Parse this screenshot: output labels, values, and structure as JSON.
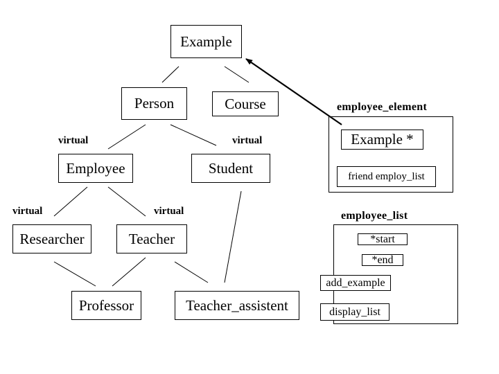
{
  "hierarchy": {
    "nodes": {
      "example": "Example",
      "person": "Person",
      "course": "Course",
      "employee": "Employee",
      "student": "Student",
      "researcher": "Researcher",
      "teacher": "Teacher",
      "professor": "Professor",
      "teacher_assistent": "Teacher_assistent"
    },
    "inheritance_labels": {
      "employee_virtual": "virtual",
      "student_virtual": "virtual",
      "researcher_virtual": "virtual",
      "teacher_virtual": "virtual"
    },
    "edges": [
      {
        "from": "example",
        "to": "person"
      },
      {
        "from": "example",
        "to": "course"
      },
      {
        "from": "person",
        "to": "employee",
        "virtual": true
      },
      {
        "from": "person",
        "to": "student",
        "virtual": true
      },
      {
        "from": "employee",
        "to": "researcher",
        "virtual": true
      },
      {
        "from": "employee",
        "to": "teacher",
        "virtual": true
      },
      {
        "from": "researcher",
        "to": "professor"
      },
      {
        "from": "teacher",
        "to": "professor"
      },
      {
        "from": "teacher",
        "to": "teacher_assistent"
      },
      {
        "from": "student",
        "to": "teacher_assistent"
      }
    ]
  },
  "employee_element": {
    "title": "employee_element",
    "members": {
      "pointer": "Example *",
      "friend": "friend employ_list"
    },
    "pointer_target": "example"
  },
  "employee_list": {
    "title": "employee_list",
    "members": {
      "start": "*start",
      "end": "*end",
      "add": "add_example",
      "display": "display_list"
    }
  }
}
